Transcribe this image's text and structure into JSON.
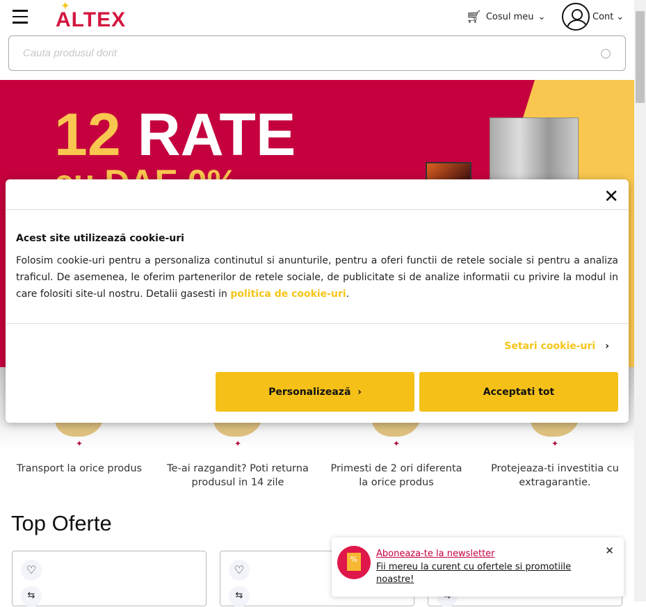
{
  "header": {
    "logo": "ALTEX",
    "cart_label": "Cosul meu",
    "account_label": "Cont"
  },
  "search": {
    "placeholder": "Cauta produsul dorit"
  },
  "banner": {
    "number": "12",
    "word": "RATE",
    "sub": "cu DAE 0%"
  },
  "features": [
    {
      "label": "Transport la orice produs"
    },
    {
      "label": "Te-ai razgandit? Poti returna produsul in 14 zile"
    },
    {
      "label": "Primesti de 2 ori diferenta la orice produs"
    },
    {
      "label": "Protejeaza-ti investitia cu extragarantie."
    }
  ],
  "top_offers": {
    "title": "Top Oferte"
  },
  "cookie": {
    "title": "Acest site utilizează cookie-uri",
    "text": "Folosim cookie-uri pentru a personaliza continutul si anunturile, pentru a oferi functii de retele sociale si pentru a analiza traficul. De asemenea, le oferim partenerilor de retele sociale, de publicitate si de analize informatii cu privire la modul in care folositi site-ul nostru. Detalii gasesti in ",
    "policy_link": "politica de cookie-uri",
    "settings_link": "Setari cookie-uri",
    "personalize_button": "Personalizează",
    "accept_button": "Acceptati tot"
  },
  "newsletter": {
    "title": "Aboneaza-te la newsletter",
    "text": "Fii mereu la curent cu ofertele si promotiile noastre!"
  }
}
